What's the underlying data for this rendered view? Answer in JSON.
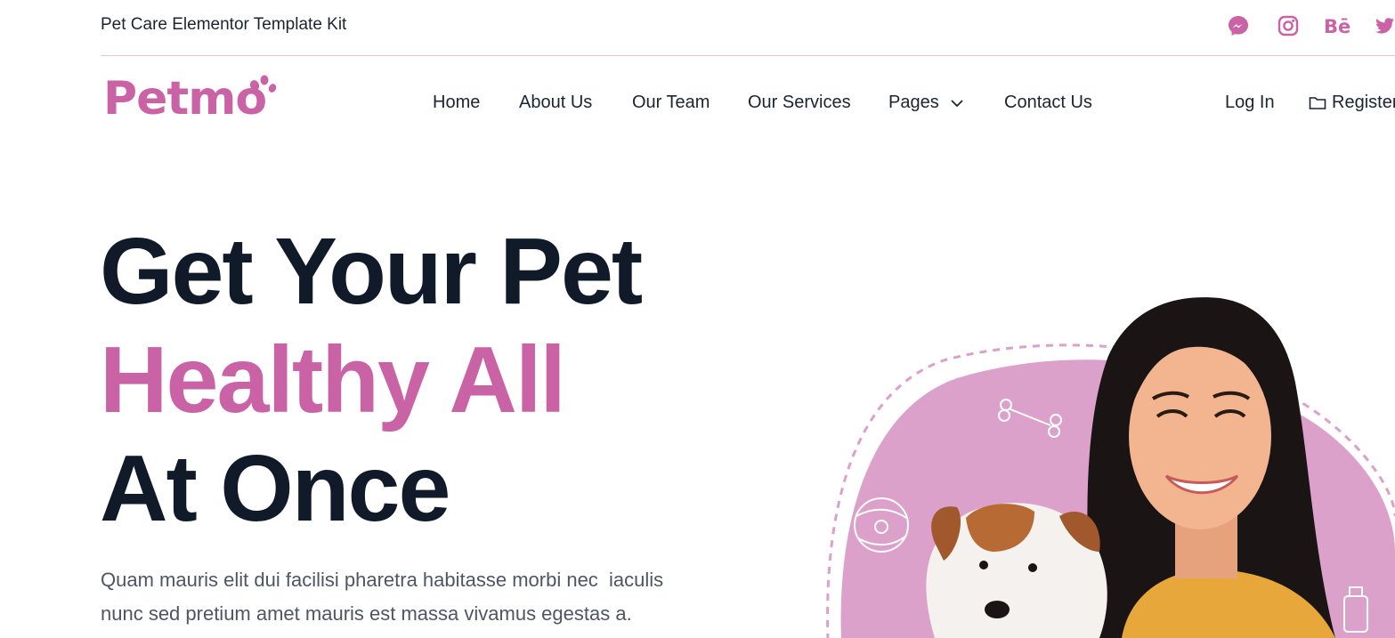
{
  "topbar": {
    "text": "Pet Care Elementor Template Kit",
    "social": [
      "messenger-icon",
      "instagram-icon",
      "behance-icon",
      "twitter-icon"
    ]
  },
  "brand": {
    "logo_text": "Petmo",
    "color": "#c963a6"
  },
  "nav": {
    "items": [
      "Home",
      "About Us",
      "Our Team",
      "Our Services",
      "Pages",
      "Contact Us"
    ],
    "login": "Log In",
    "register": "Register"
  },
  "hero": {
    "line1": "Get Your Pet",
    "line2": "Healthy All",
    "line3": "At Once",
    "description": "Quam mauris elit dui facilisi pharetra habitasse morbi nec  iaculis\nnunc sed pretium amet mauris est massa vivamus egestas a."
  },
  "colors": {
    "accent": "#c963a6",
    "heading": "#101a29",
    "blob": "#dba1cb",
    "skin": "#f2b58f",
    "hair": "#1a1414",
    "shirt": "#e8a73a"
  }
}
